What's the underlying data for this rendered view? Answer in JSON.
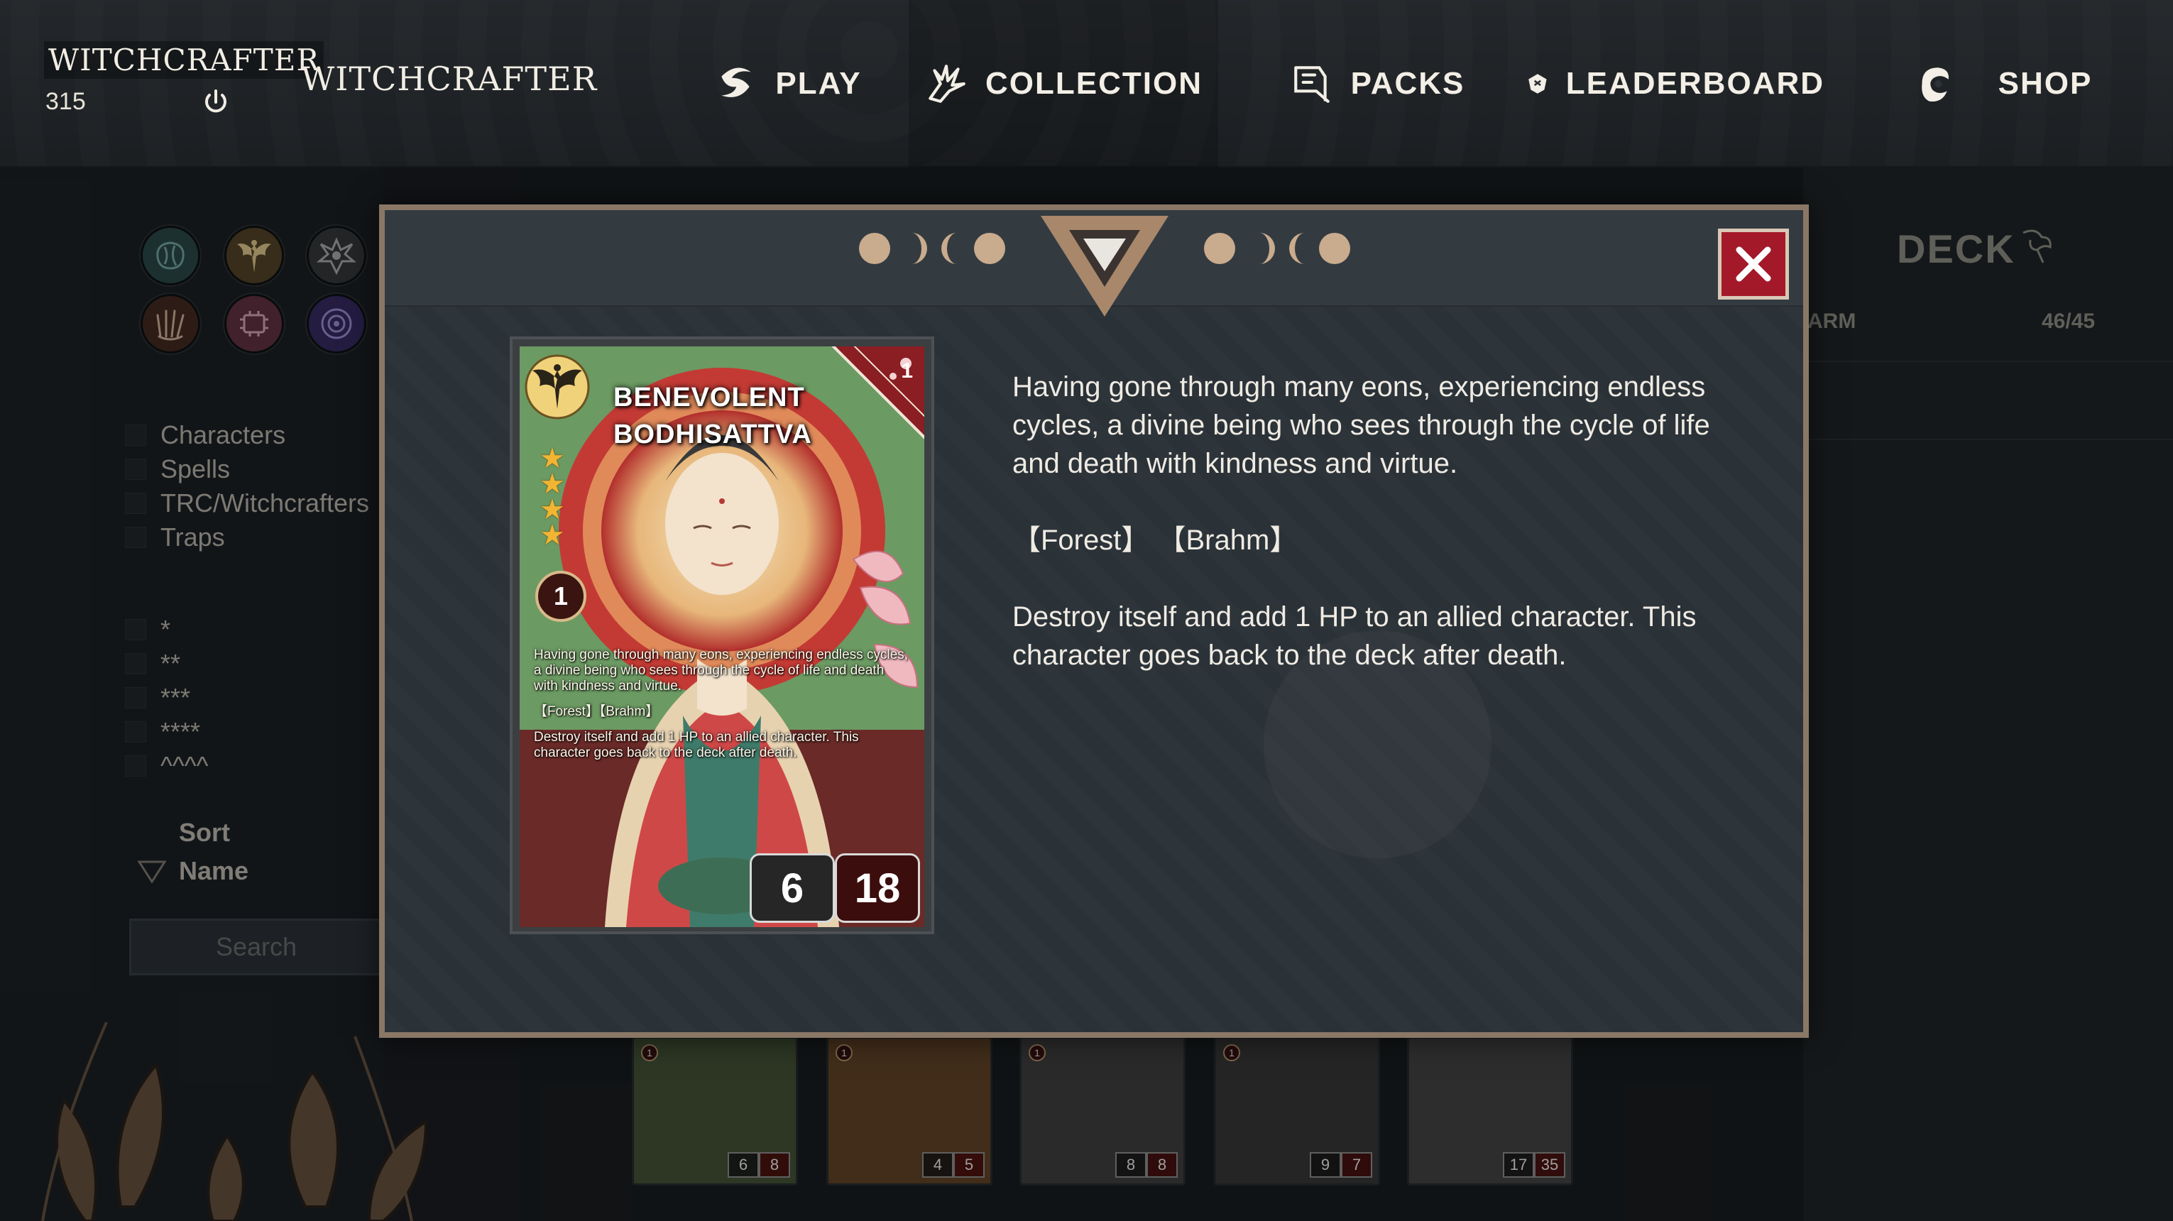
{
  "user": {
    "name": "WITCHCRAFTER",
    "coins": "315"
  },
  "logo": "WITCHCRAFTER",
  "nav": [
    {
      "label": "PLAY",
      "icon": "play-swirl-icon"
    },
    {
      "label": "COLLECTION",
      "icon": "collection-hand-icon"
    },
    {
      "label": "PACKS",
      "icon": "packs-icon"
    },
    {
      "label": "LEADERBOARD",
      "icon": "leaderboard-shield-icon"
    },
    {
      "label": "SHOP",
      "icon": "shop-icon"
    }
  ],
  "sidebar": {
    "factions": [
      "brain-faction-icon",
      "angel-faction-icon",
      "beast-faction-icon",
      "claw-faction-icon",
      "machine-faction-icon",
      "portal-faction-icon"
    ],
    "types": [
      "Characters",
      "Spells",
      "TRC/Witchcrafters",
      "Traps"
    ],
    "rarities": [
      "*",
      "**",
      "***",
      "****",
      "^^^^"
    ],
    "sort_label": "Sort",
    "sort_value": "Name",
    "search_placeholder": "Search"
  },
  "deck": {
    "title": "DECK",
    "subtitle": "ARM",
    "count": "46/45"
  },
  "background_cards": [
    {
      "cost": "1",
      "atk": "6",
      "hp": "8",
      "tone": "#4a5a3a"
    },
    {
      "cost": "1",
      "atk": "4",
      "hp": "5",
      "tone": "#6a4a2a"
    },
    {
      "cost": "1",
      "atk": "8",
      "hp": "8",
      "tone": "#444444"
    },
    {
      "cost": "1",
      "atk": "9",
      "hp": "7",
      "tone": "#3c3c3c"
    },
    {
      "cost": "",
      "atk": "17",
      "hp": "35",
      "tone": "#4a4a4a"
    }
  ],
  "modal": {
    "card": {
      "name": "BENEVOLENT BODHISATTVA",
      "corner_value": "1",
      "level": "1",
      "stars": 4,
      "text_flavor": "Having gone through many eons, experiencing endless cycles, a divine being who sees through the cycle of life and death with kindness and virtue.",
      "text_tags": "【Forest】【Brahm】",
      "text_effect": "Destroy itself and add 1 HP to an allied character. This character goes back to the deck after death.",
      "attack": "6",
      "hp": "18"
    },
    "description": {
      "flavor": "Having gone through many eons, experiencing endless cycles, a divine being who sees through the cycle of life and death with kindness and virtue.",
      "tags": "【Forest】 【Brahm】",
      "effect": "Destroy itself and add 1 HP to an allied character. This character goes back to the deck after death."
    }
  }
}
